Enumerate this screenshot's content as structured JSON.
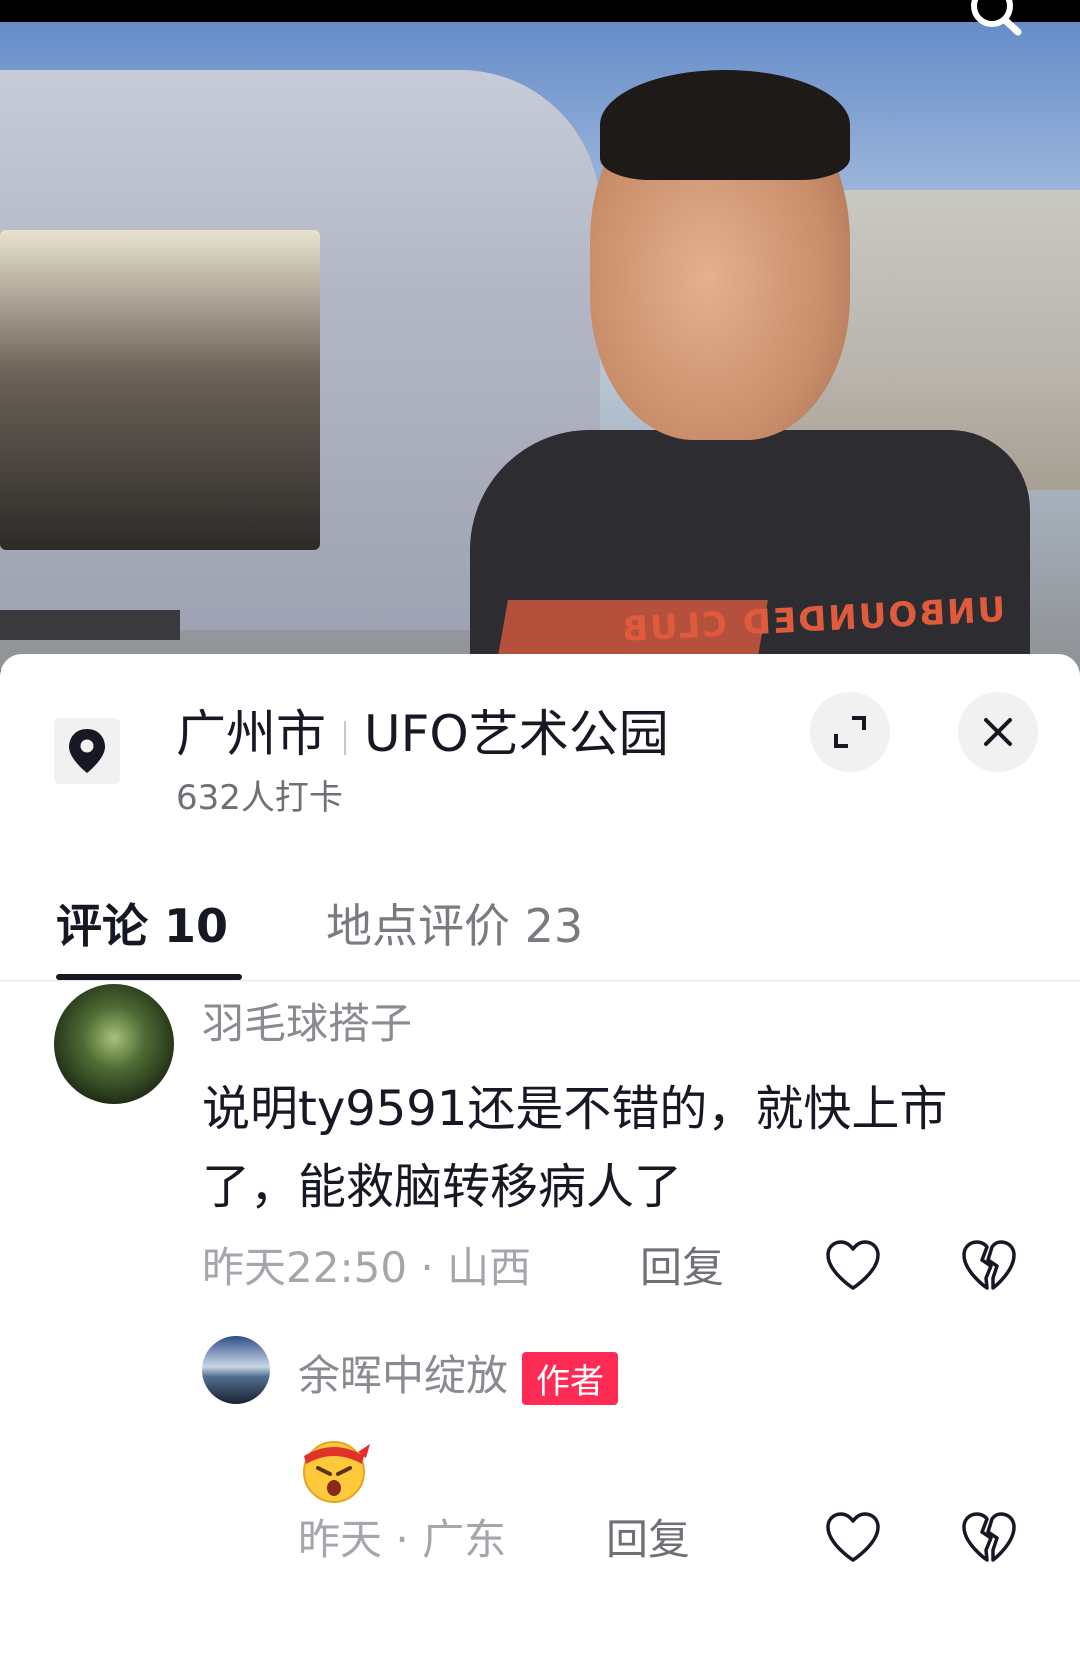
{
  "video": {
    "shirt_text": "UNBOUNDED CLUB"
  },
  "location": {
    "city": "广州市",
    "place": "UFO艺术公园",
    "checkins": "632人打卡"
  },
  "tabs": [
    {
      "label": "评论 10",
      "active": true
    },
    {
      "label": "地点评价 23",
      "active": false
    }
  ],
  "comments": [
    {
      "user": "羽毛球搭子",
      "text": "说明ty9591还是不错的，就快上市了，能救脑转移病人了",
      "time": "昨天22:50",
      "region": "山西",
      "reply": "回复",
      "icons": [
        "heart-outline-icon",
        "broken-heart-icon"
      ]
    },
    {
      "user": "余晖中绽放",
      "badge": "作者",
      "emoji": "angry-face-headband-emoji",
      "time": "昨天",
      "region": "广东",
      "reply": "回复",
      "icons": [
        "heart-outline-icon",
        "broken-heart-icon"
      ]
    }
  ],
  "colors": {
    "accent": "#fe2c55",
    "text_primary": "#161823",
    "text_secondary": "#8a8b90"
  }
}
